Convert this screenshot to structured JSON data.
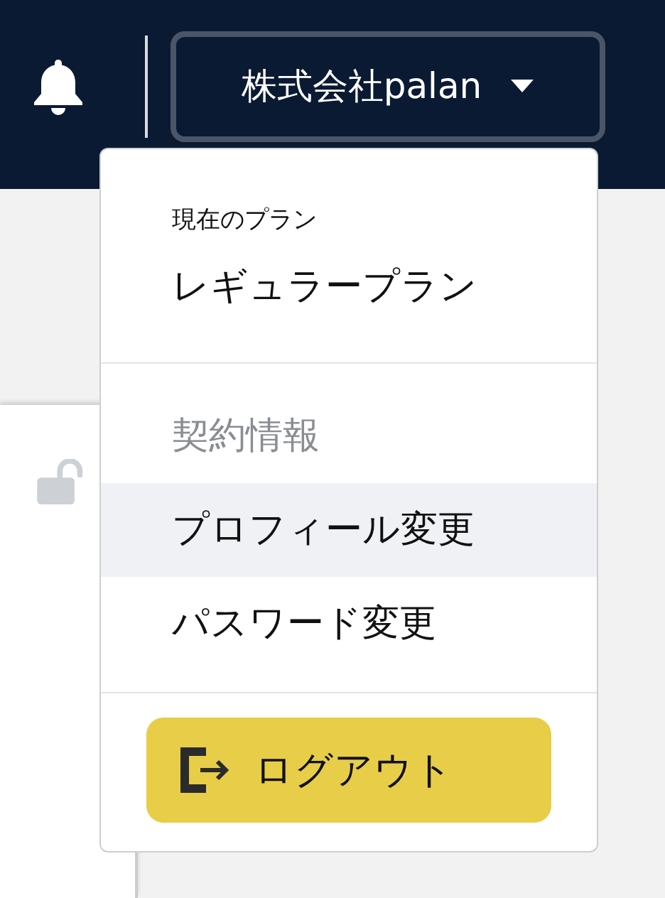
{
  "header": {
    "account_button": "株式会社palan"
  },
  "menu": {
    "plan_label": "現在のプラン",
    "plan_name": "レギュラープラン",
    "items": [
      {
        "label": "契約情報",
        "disabled": true,
        "highlighted": false
      },
      {
        "label": "プロフィール変更",
        "disabled": false,
        "highlighted": true
      },
      {
        "label": "パスワード変更",
        "disabled": false,
        "highlighted": false
      }
    ],
    "logout_button": "ログアウト"
  }
}
